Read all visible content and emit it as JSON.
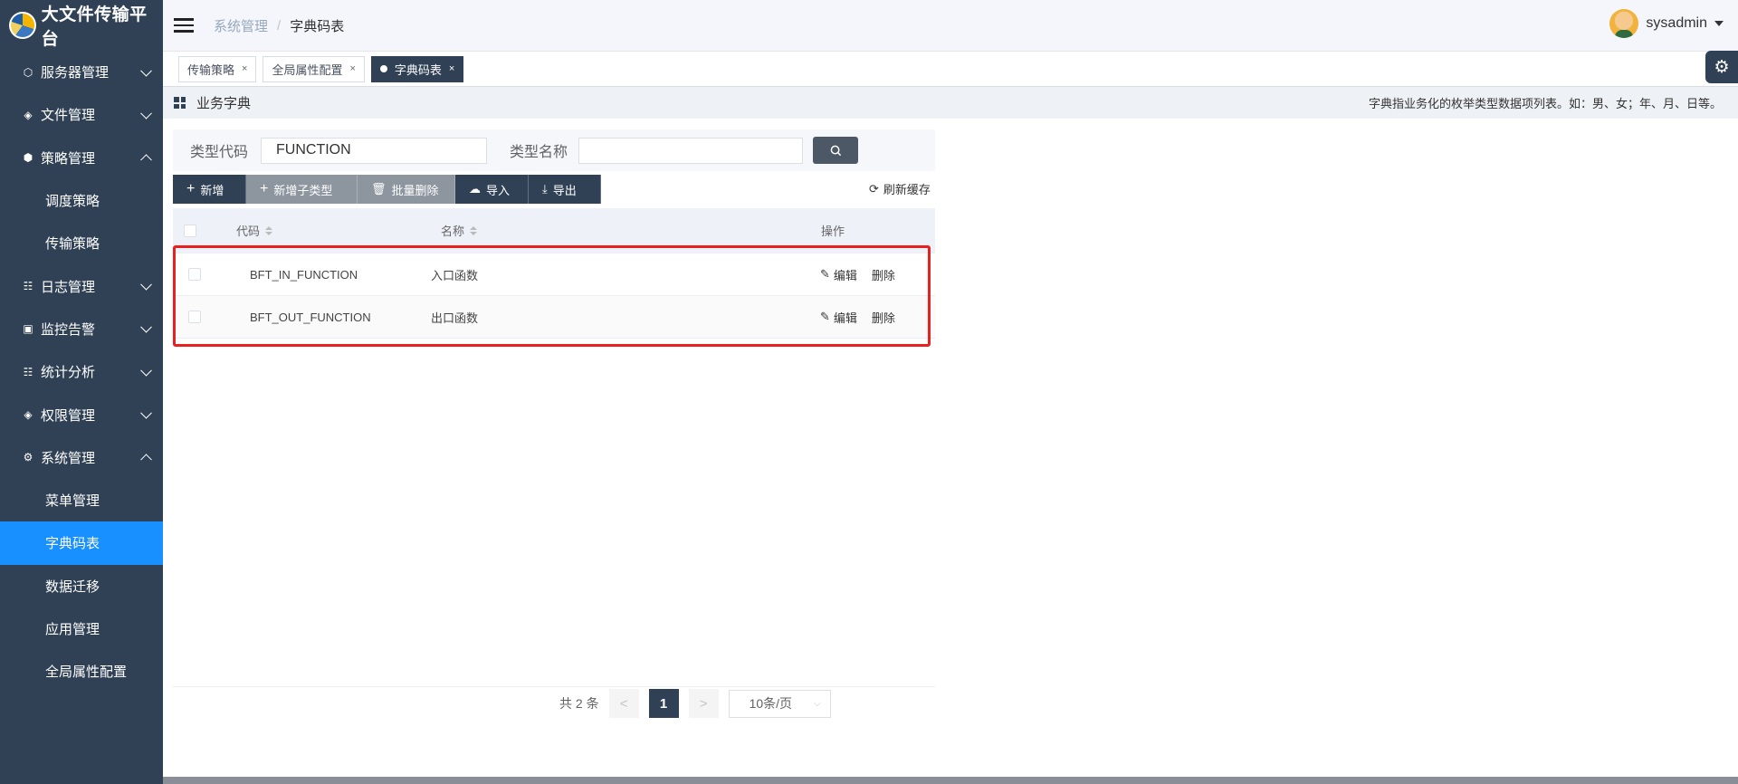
{
  "app": {
    "title": "大文件传输平台"
  },
  "sidebar": {
    "items": [
      {
        "label": "服务器管理",
        "icon": "server-icon",
        "chevron": "down"
      },
      {
        "label": "文件管理",
        "icon": "layers-icon",
        "chevron": "down"
      },
      {
        "label": "策略管理",
        "icon": "package-icon",
        "chevron": "up"
      },
      {
        "label": "调度策略",
        "sub": true
      },
      {
        "label": "传输策略",
        "sub": true
      },
      {
        "label": "日志管理",
        "icon": "list-icon",
        "chevron": "down"
      },
      {
        "label": "监控告警",
        "icon": "monitor-icon",
        "chevron": "down"
      },
      {
        "label": "统计分析",
        "icon": "list-icon",
        "chevron": "down"
      },
      {
        "label": "权限管理",
        "icon": "layers-icon",
        "chevron": "down"
      },
      {
        "label": "系统管理",
        "icon": "gear-icon",
        "chevron": "up"
      },
      {
        "label": "菜单管理",
        "sub": true
      },
      {
        "label": "字典码表",
        "sub": true,
        "active": true
      },
      {
        "label": "数据迁移",
        "sub": true
      },
      {
        "label": "应用管理",
        "sub": true
      },
      {
        "label": "全局属性配置",
        "sub": true
      }
    ]
  },
  "header": {
    "breadcrumb": [
      "系统管理",
      "字典码表"
    ],
    "user": "sysadmin"
  },
  "tabs": [
    {
      "label": "传输策略",
      "close": "×"
    },
    {
      "label": "全局属性配置",
      "close": "×"
    },
    {
      "label": "字典码表",
      "close": "×",
      "active": true
    }
  ],
  "panel": {
    "title": "业务字典",
    "description": "字典指业务化的枚举类型数据项列表。如：男、女；年、月、日等。"
  },
  "search": {
    "type_code_label": "类型代码",
    "type_code_value": "FUNCTION",
    "type_name_label": "类型名称",
    "type_name_value": ""
  },
  "toolbar": {
    "add": "新增",
    "add_subtype": "新增子类型",
    "batch_delete": "批量删除",
    "import": "导入",
    "export": "导出",
    "refresh_cache": "刷新缓存"
  },
  "table": {
    "columns": {
      "code": "代码",
      "name": "名称",
      "actions": "操作"
    },
    "rows": [
      {
        "code": "BFT_IN_FUNCTION",
        "name": "入口函数",
        "edit": "编辑",
        "delete": "删除"
      },
      {
        "code": "BFT_OUT_FUNCTION",
        "name": "出口函数",
        "edit": "编辑",
        "delete": "删除"
      }
    ]
  },
  "pagination": {
    "total": "共 2 条",
    "current_page": "1",
    "prev": "<",
    "next": ">",
    "page_size": "10条/页"
  },
  "colors": {
    "sidebar_bg": "#304156",
    "active_menu": "#1890ff",
    "highlight_border": "#e8211f"
  }
}
